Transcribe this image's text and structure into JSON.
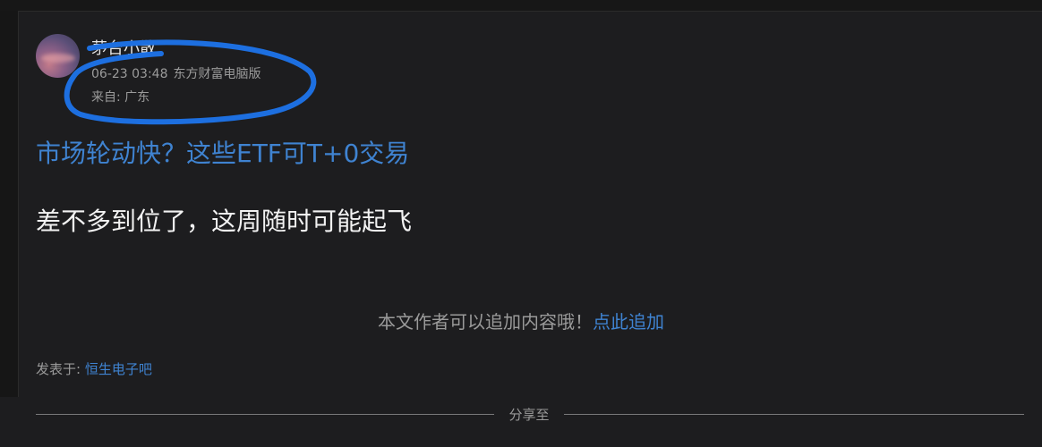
{
  "post": {
    "author": "茅台小散",
    "time": "06-23 03:48",
    "client": "东方财富电脑版",
    "origin": "来自: 广东",
    "link_title": "市场轮动快？这些ETF可T+0交易",
    "body": "差不多到位了，这周随时可能起飞"
  },
  "add_content": {
    "prompt": "本文作者可以追加内容哦！",
    "action": "点此追加"
  },
  "posted_in": {
    "label": "发表于: ",
    "forum": "恒生电子吧"
  },
  "share": {
    "label": "分享至"
  },
  "colors": {
    "background": "#1d1d1f",
    "link": "#3f83d1",
    "annotation": "#1d6fe0"
  }
}
